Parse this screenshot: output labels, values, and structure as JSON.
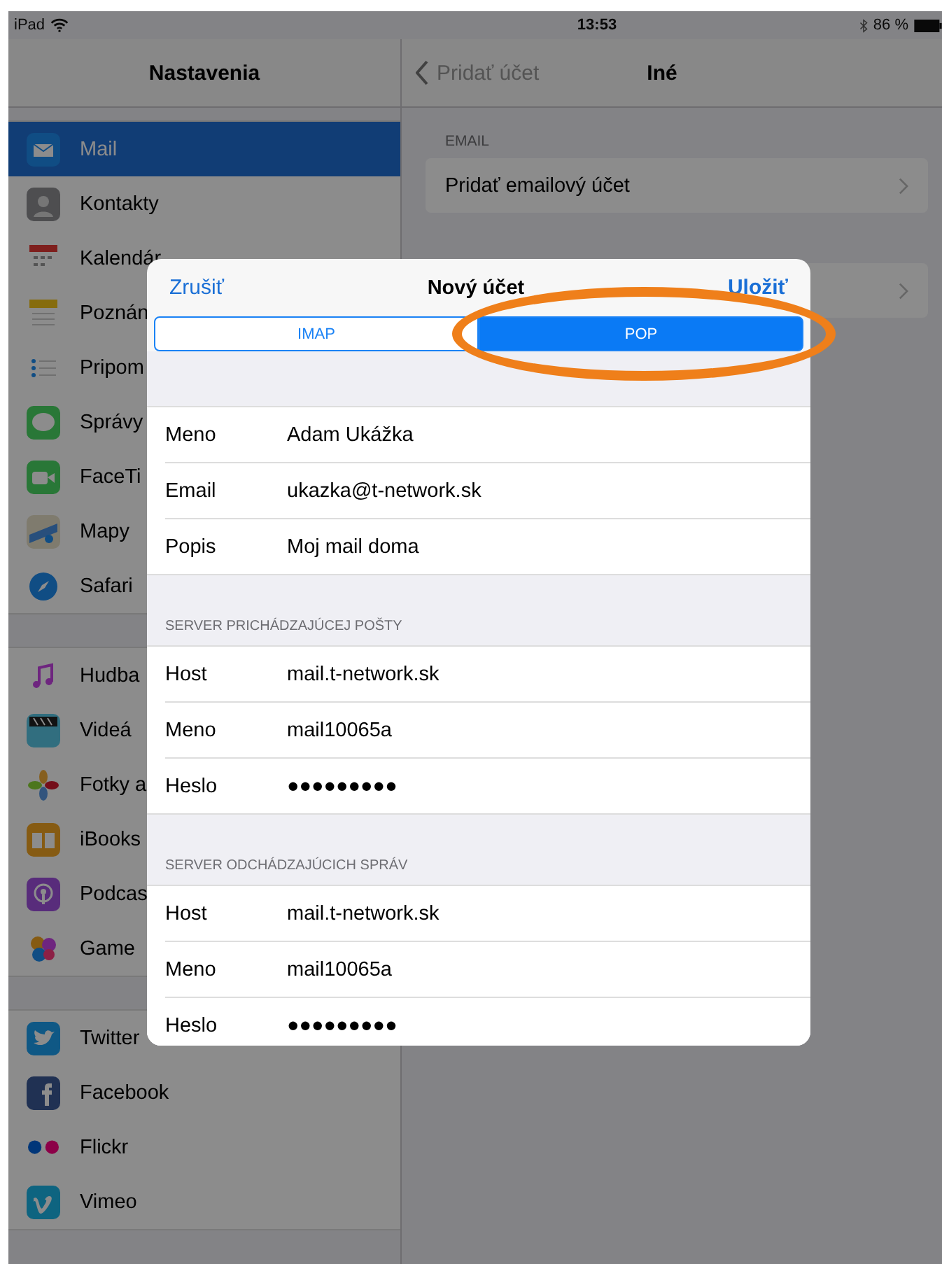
{
  "status_bar": {
    "device": "iPad",
    "time": "13:53",
    "battery": "86 %"
  },
  "sidebar": {
    "title": "Nastavenia",
    "groups": [
      [
        {
          "label": "Mail",
          "kind": "mail",
          "selected": true
        },
        {
          "label": "Kontakty",
          "kind": "contacts",
          "selected": false
        },
        {
          "label": "Kalendár",
          "kind": "calendar",
          "selected": false
        },
        {
          "label": "Poznán",
          "kind": "notes",
          "selected": false
        },
        {
          "label": "Pripom",
          "kind": "reminders",
          "selected": false
        },
        {
          "label": "Správy",
          "kind": "messages",
          "selected": false
        },
        {
          "label": "FaceTi",
          "kind": "facetime",
          "selected": false
        },
        {
          "label": "Mapy",
          "kind": "maps",
          "selected": false
        },
        {
          "label": "Safari",
          "kind": "safari",
          "selected": false
        }
      ],
      [
        {
          "label": "Hudba",
          "kind": "music",
          "selected": false
        },
        {
          "label": "Videá",
          "kind": "videos",
          "selected": false
        },
        {
          "label": "Fotky a",
          "kind": "photos",
          "selected": false
        },
        {
          "label": "iBooks",
          "kind": "books",
          "selected": false
        },
        {
          "label": "Podcas",
          "kind": "podcasts",
          "selected": false
        },
        {
          "label": "Game",
          "kind": "gamecenter",
          "selected": false
        }
      ],
      [
        {
          "label": "Twitter",
          "kind": "twitter",
          "selected": false
        },
        {
          "label": "Facebook",
          "kind": "facebook",
          "selected": false
        },
        {
          "label": "Flickr",
          "kind": "flickr",
          "selected": false
        },
        {
          "label": "Vimeo",
          "kind": "vimeo",
          "selected": false
        }
      ]
    ]
  },
  "detail": {
    "back": "Pridať účet",
    "title": "Iné",
    "sections": [
      {
        "header": "EMAIL",
        "rows": [
          {
            "kind": "link",
            "label": "Pridať emailový účet"
          }
        ]
      },
      {
        "rows": [
          {
            "kind": "covered"
          }
        ]
      }
    ]
  },
  "modal": {
    "cancel": "Zrušiť",
    "title": "Nový účet",
    "save": "Uložiť",
    "segments": [
      {
        "label": "IMAP",
        "selected": false,
        "highlighted": false
      },
      {
        "label": "POP",
        "selected": true,
        "highlighted": true
      }
    ],
    "sections": [
      {
        "rows": [
          {
            "label": "Meno",
            "value": "Adam Ukážka"
          },
          {
            "label": "Email",
            "value": "ukazka@t-network.sk"
          },
          {
            "label": "Popis",
            "value": "Moj mail doma"
          }
        ]
      },
      {
        "header": "SERVER PRICHÁDZAJÚCEJ POŠTY",
        "rows": [
          {
            "label": "Host",
            "value": "mail.t-network.sk"
          },
          {
            "label": "Meno",
            "value": "mail10065a"
          },
          {
            "label": "Heslo",
            "value": "●●●●●●●●●"
          }
        ]
      },
      {
        "header": "SERVER ODCHÁDZAJÚCICH SPRÁV",
        "rows": [
          {
            "label": "Host",
            "value": "mail.t-network.sk"
          },
          {
            "label": "Meno",
            "value": "mail10065a"
          },
          {
            "label": "Heslo",
            "value": "●●●●●●●●●"
          }
        ]
      }
    ]
  }
}
